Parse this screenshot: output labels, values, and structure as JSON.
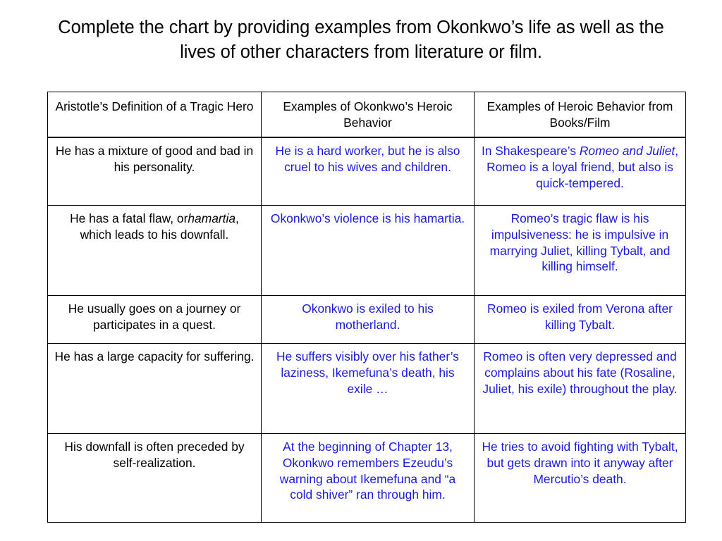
{
  "slide": {
    "title": "Complete the chart by providing examples from Okonkwo’s life as well as the lives of other characters from literature or film."
  },
  "table": {
    "headers": [
      "Aristotle’s Definition of a Tragic Hero",
      "Examples of Okonkwo’s Heroic Behavior",
      "Examples of Heroic Behavior from Books/Film"
    ],
    "rows": [
      {
        "definition_html": "He has a mixture of good and bad in his personality.",
        "okonkwo_html": "He is a hard worker, but he is also cruel to his wives and children.",
        "books_html": "In Shakespeare’s <em>Romeo and Juliet</em>, Romeo is a loyal friend, but also is quick-tempered."
      },
      {
        "definition_html": "He has a fatal flaw, or<em>hamartia</em>, which leads to his downfall.",
        "okonkwo_html": "Okonkwo’s violence is his hamartia.",
        "books_html": "Romeo’s tragic flaw is his impulsiveness: he is impulsive in marrying Juliet, killing Tybalt, and killing himself."
      },
      {
        "definition_html": "He usually goes on a journey or participates in a quest.",
        "okonkwo_html": "Okonkwo is exiled to his motherland.",
        "books_html": "Romeo is exiled from Verona after killing Tybalt."
      },
      {
        "definition_html": "He has a large capacity for suffering.",
        "okonkwo_html": "He suffers visibly over his father’s laziness, Ikemefuna’s death, his exile …",
        "books_html": "Romeo is often very depressed and complains about his fate (Rosaline, Juliet, his exile) throughout the play."
      },
      {
        "definition_html": "His downfall is often preceded by self-realization.",
        "okonkwo_html": "At the beginning of Chapter 13, Okonkwo remembers Ezeudu’s warning about Ikemefuna and “a cold shiver” ran through him.",
        "books_html": "He tries to avoid fighting with Tybalt, but gets drawn into it anyway after Mercutio’s death."
      }
    ]
  },
  "colors": {
    "text_black": "#000000",
    "text_blue": "#1a1ae0",
    "border": "#000000",
    "background": "#ffffff"
  }
}
